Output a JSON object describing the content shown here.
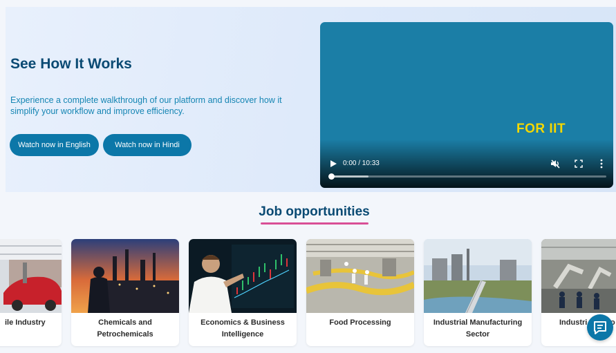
{
  "hero": {
    "title": "See How It Works",
    "description": "Experience a complete walkthrough of our platform and discover how it simplify your workflow and improve efficiency.",
    "buttons": {
      "english": "Watch now in English",
      "hindi": "Watch now in Hindi"
    }
  },
  "video": {
    "overlay_text": "FOR IIT",
    "time_display": "0:00 / 10:33",
    "progress_fraction": 0,
    "buffered_fraction": 0.14,
    "icons": [
      "play-icon",
      "mute-icon",
      "fullscreen-icon",
      "more-options-icon"
    ]
  },
  "jobs": {
    "title": "Job opportunities",
    "cards": [
      {
        "label": "ile Industry"
      },
      {
        "label": "Chemicals and Petrochemicals"
      },
      {
        "label": "Economics & Business Intelligence"
      },
      {
        "label": "Food Processing"
      },
      {
        "label": "Industrial Manufacturing Sector"
      },
      {
        "label": "Industri"
      }
    ],
    "last_card_trailing": "o"
  },
  "chat": {
    "icon": "chat-icon"
  },
  "colors": {
    "accent": "#0c77a8",
    "heading": "#0a4a73",
    "underline": "#d94f96",
    "video_bg": "#1b7ea6",
    "overlay_text": "#f5d800"
  }
}
